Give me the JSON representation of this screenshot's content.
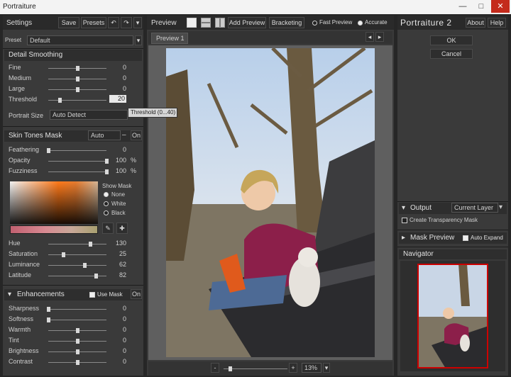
{
  "window": {
    "title": "Portraiture",
    "minimize": "—",
    "maximize": "□",
    "close": "✕"
  },
  "settings": {
    "header": "Settings",
    "save": "Save",
    "presets": "Presets",
    "preset_label": "Preset",
    "preset_value": "Default",
    "detail_smoothing_title": "Detail Smoothing",
    "sliders": [
      {
        "label": "Fine",
        "value": "0",
        "pos": 0.5
      },
      {
        "label": "Medium",
        "value": "0",
        "pos": 0.5
      },
      {
        "label": "Large",
        "value": "0",
        "pos": 0.5
      },
      {
        "label": "Threshold",
        "value": "20",
        "pos": 0.2
      }
    ],
    "tooltip": "Threshold (0...40)",
    "portrait_size_label": "Portrait Size",
    "portrait_size_value": "Auto Detect"
  },
  "skin": {
    "title": "Skin Tones Mask",
    "mode": "Auto",
    "toggle": "On",
    "sliders": [
      {
        "label": "Feathering",
        "value": "0",
        "pos": 0.0
      },
      {
        "label": "Opacity",
        "value": "100",
        "unit": "%",
        "pos": 1.0
      },
      {
        "label": "Fuzziness",
        "value": "100",
        "unit": "%",
        "pos": 1.0
      }
    ],
    "show_mask_label": "Show Mask",
    "show_mask_options": [
      "None",
      "White",
      "Black"
    ],
    "show_mask_selected": 0,
    "hsl": [
      {
        "label": "Hue",
        "value": "130",
        "pos": 0.72
      },
      {
        "label": "Saturation",
        "value": "25",
        "pos": 0.25
      },
      {
        "label": "Luminance",
        "value": "62",
        "pos": 0.62
      },
      {
        "label": "Latitude",
        "value": "82",
        "pos": 0.82
      }
    ]
  },
  "enhancements": {
    "title": "Enhancements",
    "use_mask": "Use Mask",
    "toggle": "On",
    "sliders": [
      {
        "label": "Sharpness",
        "value": "0",
        "pos": 0.0
      },
      {
        "label": "Softness",
        "value": "0",
        "pos": 0.0
      },
      {
        "label": "Warmth",
        "value": "0",
        "pos": 0.5
      },
      {
        "label": "Tint",
        "value": "0",
        "pos": 0.5
      },
      {
        "label": "Brightness",
        "value": "0",
        "pos": 0.5
      },
      {
        "label": "Contrast",
        "value": "0",
        "pos": 0.5
      }
    ]
  },
  "preview": {
    "header": "Preview",
    "add_preview": "Add Preview",
    "bracketing": "Bracketing",
    "fast_preview": "Fast Preview",
    "accurate": "Accurate",
    "accurate_selected": true,
    "tab": "Preview 1",
    "zoom_minus": "-",
    "zoom_plus": "+",
    "zoom_value": "13%",
    "zoom_pos": 0.1
  },
  "right": {
    "brand": "Portraiture 2",
    "about": "About",
    "help": "Help",
    "ok": "OK",
    "cancel": "Cancel",
    "output_label": "Output",
    "output_value": "Current Layer",
    "create_mask": "Create Transparency Mask",
    "mask_preview": "Mask Preview",
    "auto_expand": "Auto Expand",
    "navigator": "Navigator"
  },
  "colors": {
    "accent": "#cc0000",
    "panel": "#3a3a3a",
    "background": "#262626"
  }
}
